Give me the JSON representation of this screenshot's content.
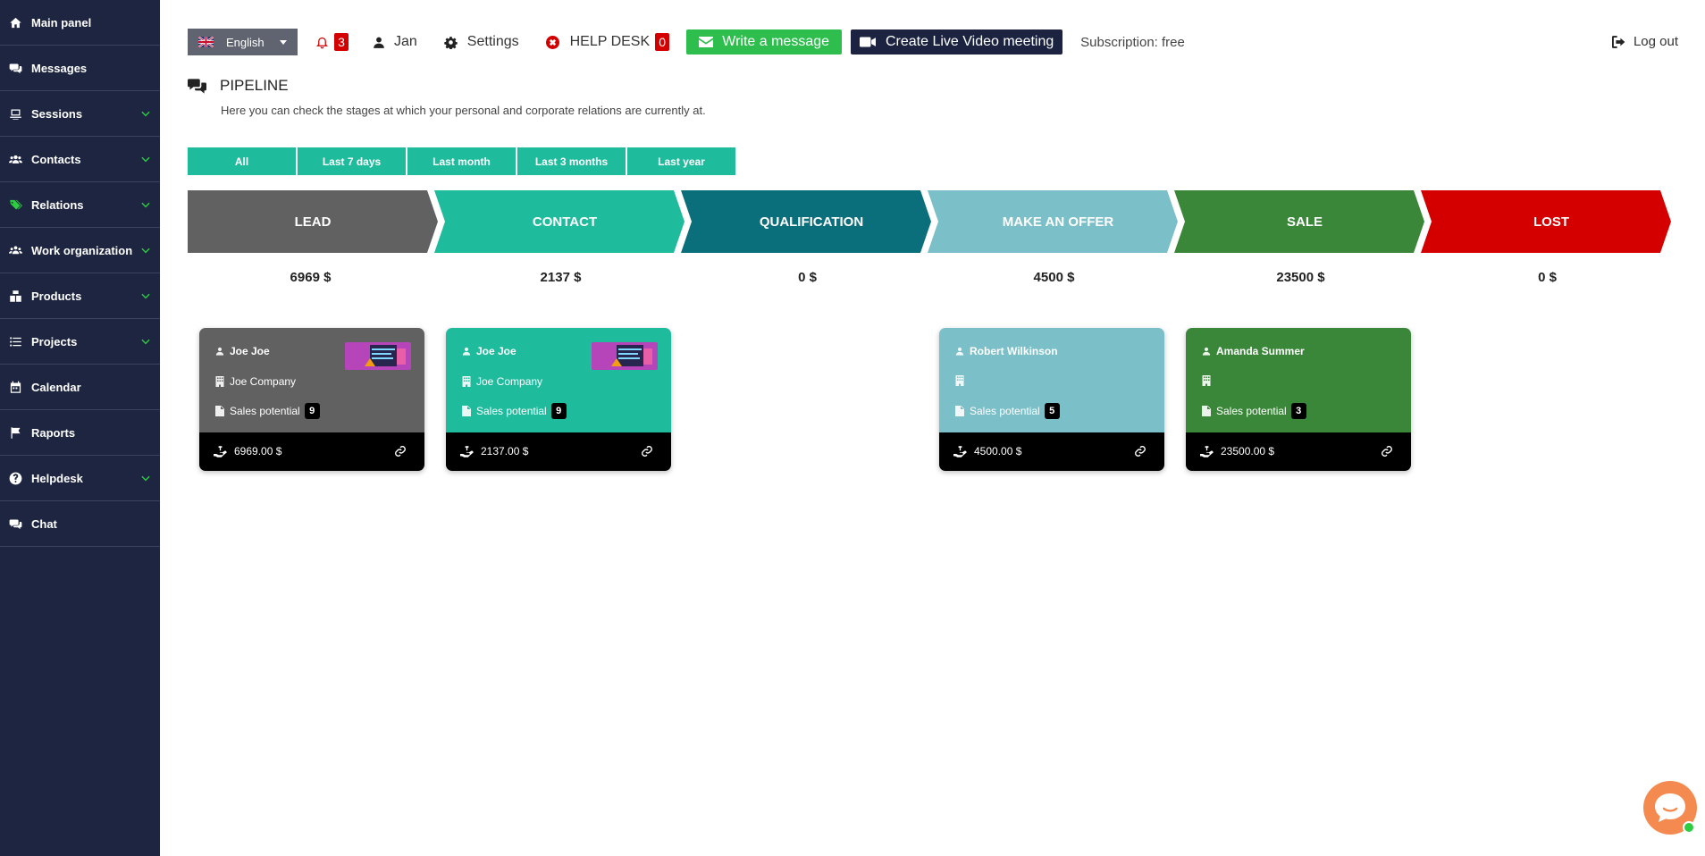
{
  "sidebar": {
    "items": [
      {
        "label": "Main panel",
        "icon": "home-icon",
        "expandable": false
      },
      {
        "label": "Messages",
        "icon": "messages-icon",
        "expandable": false
      },
      {
        "label": "Sessions",
        "icon": "sessions-icon",
        "expandable": true
      },
      {
        "label": "Contacts",
        "icon": "contacts-icon",
        "expandable": true
      },
      {
        "label": "Relations",
        "icon": "tags-icon",
        "expandable": true,
        "active": true
      },
      {
        "label": "Work organization",
        "icon": "work-organization-icon",
        "expandable": true
      },
      {
        "label": "Products",
        "icon": "products-icon",
        "expandable": true
      },
      {
        "label": "Projects",
        "icon": "projects-icon",
        "expandable": true
      },
      {
        "label": "Calendar",
        "icon": "calendar-icon",
        "expandable": false
      },
      {
        "label": "Raports",
        "icon": "flag-icon",
        "expandable": false
      },
      {
        "label": "Helpdesk",
        "icon": "question-icon",
        "expandable": true
      },
      {
        "label": "Chat",
        "icon": "chat-icon",
        "expandable": false
      }
    ]
  },
  "topbar": {
    "language": "English",
    "notifications_count": "3",
    "user_name": "Jan",
    "settings_label": "Settings",
    "helpdesk_label": "HELP DESK",
    "helpdesk_count": "0",
    "write_message_label": "Write a message",
    "video_meeting_label": "Create Live Video meeting",
    "subscription": "Subscription: free",
    "logout_label": "Log out"
  },
  "header": {
    "title": "PIPELINE",
    "description": "Here you can check the stages at which your personal and corporate relations are currently at."
  },
  "filters": [
    "All",
    "Last 7 days",
    "Last month",
    "Last 3 months",
    "Last year"
  ],
  "stages": [
    {
      "name": "LEAD",
      "total": "6969 $",
      "color": "#616161"
    },
    {
      "name": "CONTACT",
      "total": "2137 $",
      "color": "#1fbb9d"
    },
    {
      "name": "QUALIFICATION",
      "total": "0 $",
      "color": "#0b6f7b"
    },
    {
      "name": "MAKE AN OFFER",
      "total": "4500 $",
      "color": "#7bbfc8"
    },
    {
      "name": "SALE",
      "total": "23500 $",
      "color": "#3b873a"
    },
    {
      "name": "LOST",
      "total": "0 $",
      "color": "#d40000"
    }
  ],
  "cards": [
    {
      "name": "Joe Joe",
      "company": "Joe Company",
      "potential_label": "Sales potential",
      "potential": "9",
      "amount": "6969.00 $",
      "color": "#616161",
      "has_image": true
    },
    {
      "name": "Joe Joe",
      "company": "Joe Company",
      "potential_label": "Sales potential",
      "potential": "9",
      "amount": "2137.00 $",
      "color": "#1fbb9d",
      "has_image": true
    },
    {
      "name": "Robert Wilkinson",
      "company": "",
      "potential_label": "Sales potential",
      "potential": "5",
      "amount": "4500.00 $",
      "color": "#7bbfc8",
      "has_image": false
    },
    {
      "name": "Amanda Summer",
      "company": "",
      "potential_label": "Sales potential",
      "potential": "3",
      "amount": "23500.00 $",
      "color": "#3b873a",
      "has_image": false
    }
  ],
  "colors": {
    "sidebar_bg": "#1d2541",
    "accent_green": "#2ecc40",
    "teal": "#1fbb9d",
    "alert_red": "#d40000",
    "chat_orange": "#f48a4f"
  }
}
